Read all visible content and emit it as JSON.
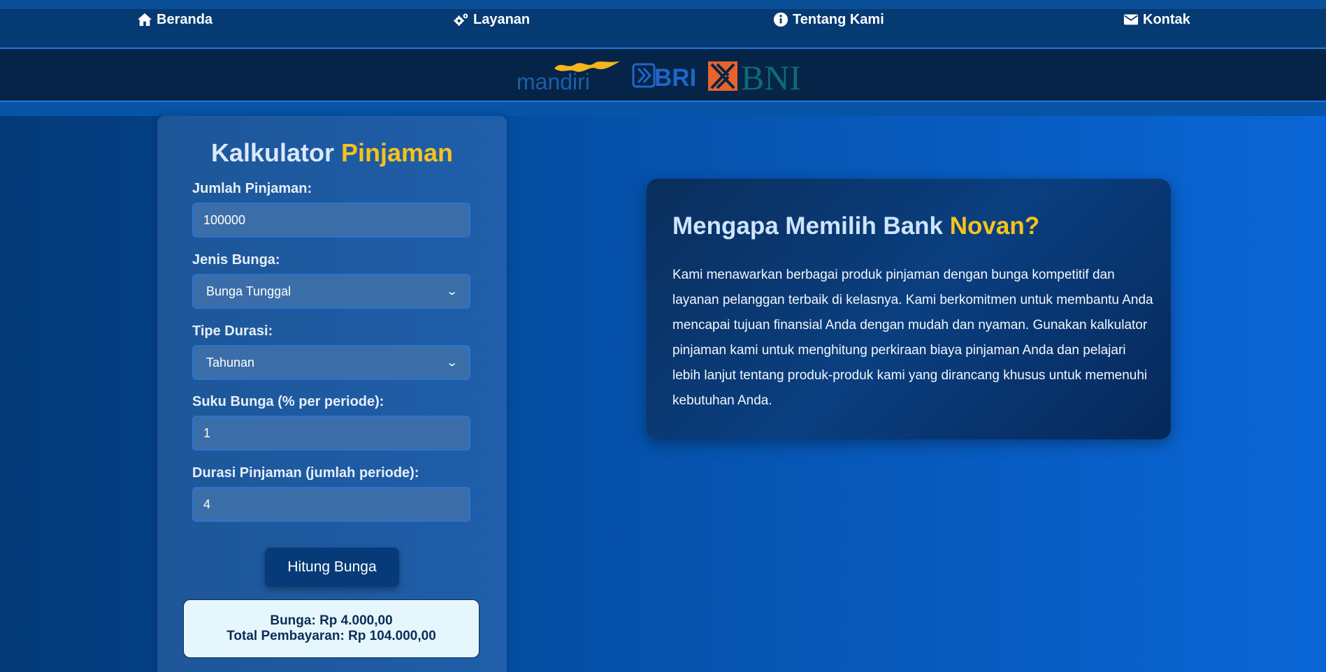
{
  "nav": {
    "items": [
      {
        "label": "Beranda",
        "icon": "home-icon"
      },
      {
        "label": "Layanan",
        "icon": "gears-icon"
      },
      {
        "label": "Tentang Kami",
        "icon": "info-icon"
      },
      {
        "label": "Kontak",
        "icon": "envelope-icon"
      }
    ]
  },
  "logos": {
    "mandiri": "mandiri",
    "bri": "BRI",
    "bni": "BNI"
  },
  "calculator": {
    "title_main": "Kalkulator",
    "title_highlight": "Pinjaman",
    "amount_label": "Jumlah Pinjaman:",
    "amount_value": "100000",
    "interest_type_label": "Jenis Bunga:",
    "interest_type_value": "Bunga Tunggal",
    "duration_type_label": "Tipe Durasi:",
    "duration_type_value": "Tahunan",
    "rate_label": "Suku Bunga (% per periode):",
    "rate_value": "1",
    "duration_label": "Durasi Pinjaman (jumlah periode):",
    "duration_value": "4",
    "button_label": "Hitung Bunga",
    "result_interest": "Bunga: Rp 4.000,00",
    "result_total": "Total Pembayaran: Rp 104.000,00"
  },
  "info": {
    "title_main": "Mengapa Memilih Bank",
    "title_highlight": "Novan?",
    "body": "Kami menawarkan berbagai produk pinjaman dengan bunga kompetitif dan layanan pelanggan terbaik di kelasnya. Kami berkomitmen untuk membantu Anda mencapai tujuan finansial Anda dengan mudah dan nyaman. Gunakan kalkulator pinjaman kami untuk menghitung perkiraan biaya pinjaman Anda dan pelajari lebih lanjut tentang produk-produk kami yang dirancang khusus untuk memenuhi kebutuhan Anda."
  },
  "colors": {
    "accent": "#f6c21c",
    "nav_bg": "#053a72",
    "logo_bar_bg": "#052447",
    "button_bg": "#063a78",
    "result_bg": "#e6f6fd"
  }
}
